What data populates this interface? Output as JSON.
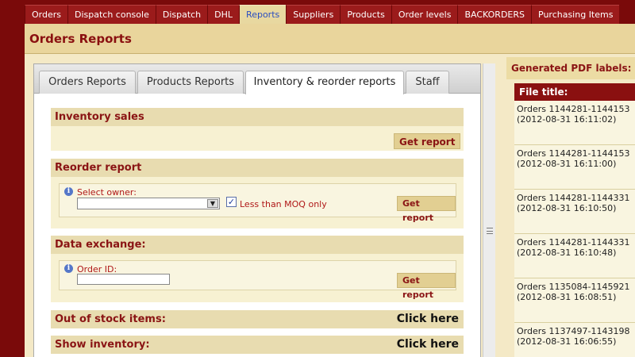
{
  "nav": {
    "items": [
      {
        "label": "Orders",
        "active": false
      },
      {
        "label": "Dispatch console",
        "active": false
      },
      {
        "label": "Dispatch",
        "active": false
      },
      {
        "label": "DHL",
        "active": false
      },
      {
        "label": "Reports",
        "active": true
      },
      {
        "label": "Suppliers",
        "active": false
      },
      {
        "label": "Products",
        "active": false
      },
      {
        "label": "Order levels",
        "active": false
      },
      {
        "label": "BACKORDERS",
        "active": false
      },
      {
        "label": "Purchasing Items",
        "active": false
      }
    ]
  },
  "header": {
    "title": "Orders Reports"
  },
  "tabs": [
    {
      "label": "Orders Reports",
      "active": false
    },
    {
      "label": "Products Reports",
      "active": false
    },
    {
      "label": "Inventory & reorder reports",
      "active": true
    },
    {
      "label": "Staff",
      "active": false
    }
  ],
  "sections": {
    "inventory_sales": {
      "title": "Inventory sales",
      "button": "Get report"
    },
    "reorder": {
      "title": "Reorder report",
      "owner_label": "Select owner:",
      "owner_value": "",
      "moq_label": "Less than MOQ only",
      "moq_checked": true,
      "button": "Get report"
    },
    "data_exchange": {
      "title": "Data exchange:",
      "order_id_label": "Order ID:",
      "order_id_value": "",
      "button": "Get report"
    },
    "out_of_stock": {
      "title": "Out of stock items:",
      "link": "Click here"
    },
    "show_inventory": {
      "title": "Show inventory:",
      "link": "Click here"
    }
  },
  "right_panel": {
    "title": "Generated PDF labels:",
    "column": "File title:",
    "rows": [
      {
        "name": "Orders 1144281-1144153",
        "date": "(2012-08-31 16:11:02)"
      },
      {
        "name": "Orders 1144281-1144153",
        "date": "(2012-08-31 16:11:00)"
      },
      {
        "name": "Orders 1144281-1144331",
        "date": "(2012-08-31 16:10:50)"
      },
      {
        "name": "Orders 1144281-1144331",
        "date": "(2012-08-31 16:10:48)"
      },
      {
        "name": "Orders 1135084-1145921",
        "date": "(2012-08-31 16:08:51)"
      },
      {
        "name": "Orders 1137497-1143198",
        "date": "(2012-08-31 16:06:55)"
      }
    ]
  },
  "icons": {
    "info": "info-icon",
    "dropdown": "chevron-down-icon",
    "check": "check-icon"
  },
  "colors": {
    "brand": "#7a0a0a",
    "accent": "#8a1414",
    "header_bg": "#e9d59c"
  }
}
